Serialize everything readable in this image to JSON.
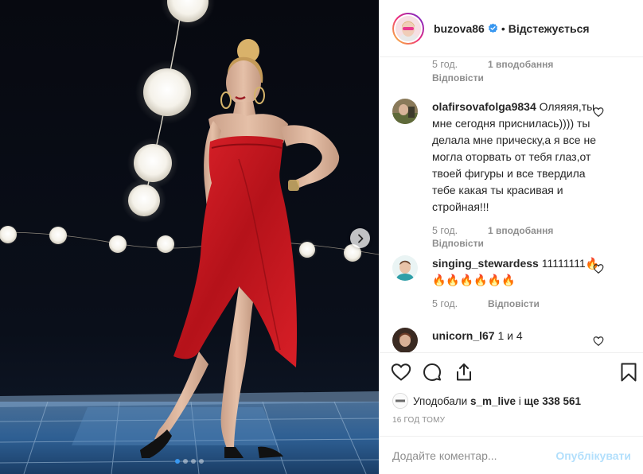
{
  "header": {
    "username": "buzova86",
    "separator": "•",
    "follow_status": "Відстежується",
    "verified": true
  },
  "top_comment_meta": {
    "age": "5 год.",
    "likes": "1 вподобання",
    "reply": "Відповісти"
  },
  "comments": [
    {
      "author": "olafirsovafolga9834",
      "text": "Оляяяя,ты мне сегодня приснилась)))) ты делала мне прическу,а я все не могла оторвать от тебя глаз,от твоей фигуры и все твердила тебе какая ты красивая и стройная!!!",
      "age": "5 год.",
      "likes": "1 вподобання",
      "reply": "Відповісти"
    },
    {
      "author": "singing_stewardess",
      "text": "11111111🔥🔥🔥🔥🔥🔥🔥",
      "age": "5 год.",
      "reply": "Відповісти"
    },
    {
      "author": "unicorn_l67",
      "text": "1 и 4"
    }
  ],
  "likes": {
    "prefix": "Уподобали ",
    "user": "s_m_live",
    "middle": " і ",
    "count": "ще 338 561"
  },
  "timestamp": "16 ГОД ТОМУ",
  "add_comment": {
    "placeholder": "Додайте коментар...",
    "post_label": "Опублікувати"
  },
  "carousel": {
    "total_slides": 4,
    "active_index": 0
  },
  "icons": [
    "verified-badge-icon",
    "heart-icon",
    "comment-icon",
    "share-icon",
    "bookmark-icon",
    "chevron-right-icon"
  ],
  "colors": {
    "accent": "#3897f0",
    "text": "#262626",
    "muted": "#8e8e8e",
    "post_disabled": "#b2dffc",
    "dress": "#c8161d"
  }
}
